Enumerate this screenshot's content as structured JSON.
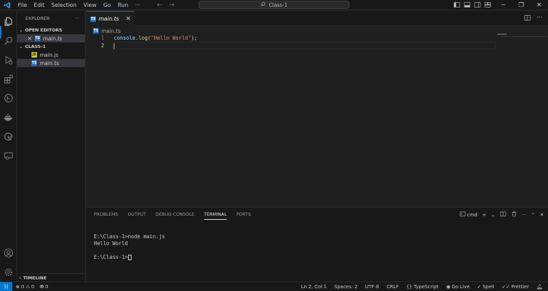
{
  "titlebar": {
    "menu": [
      "File",
      "Edit",
      "Selection",
      "View",
      "Go",
      "Run",
      "···"
    ],
    "search_text": "Class-1"
  },
  "explorer": {
    "header": "EXPLORER",
    "more": "···",
    "open_editors_label": "OPEN EDITORS",
    "open_editors": [
      {
        "name": "main.ts",
        "type": "ts"
      }
    ],
    "folder_label": "CLASS-1",
    "files": [
      {
        "name": "main.js",
        "type": "js"
      },
      {
        "name": "main.ts",
        "type": "ts"
      }
    ],
    "timeline_label": "TIMELINE"
  },
  "editor": {
    "tab_label": "main.ts",
    "breadcrumb": "main.ts",
    "line_numbers": [
      "1",
      "2"
    ],
    "code": {
      "ident": "console",
      "dot": ".",
      "fn": "log",
      "open": "(",
      "str": "\"Hello World\"",
      "close": ");"
    }
  },
  "panel": {
    "tabs": [
      "PROBLEMS",
      "OUTPUT",
      "DEBUG CONSOLE",
      "TERMINAL",
      "PORTS"
    ],
    "active_tab": "TERMINAL",
    "shell": "cmd",
    "terminal_lines": [
      "E:\\Class-1>node main.js",
      "Hello World",
      "",
      "E:\\Class-1>"
    ]
  },
  "statusbar": {
    "errors": "0",
    "warnings": "0",
    "ports": "0",
    "position": "Ln 2, Col 1",
    "spaces": "Spaces: 2",
    "encoding": "UTF-8",
    "eol": "CRLF",
    "language": "TypeScript",
    "golive": "Go Live",
    "spell": "Spell",
    "prettier": "Prettier"
  },
  "colors": {
    "accent": "#0078d4",
    "ts_badge": "#3178c6",
    "js_badge": "#cbcb41"
  }
}
